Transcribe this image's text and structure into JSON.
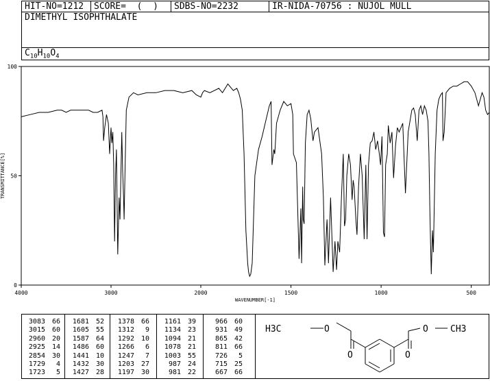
{
  "header": {
    "hit": "HIT-NO=1212",
    "score": "SCORE=  (  )",
    "sdbs": "SDBS-NO=2232",
    "ir": "IR-NIDA-70756 : NUJOL MULL"
  },
  "compound": {
    "name": "DIMETHYL ISOPHTHALATE",
    "formula_parts": [
      "C",
      "10",
      "H",
      "10",
      "O",
      "4"
    ]
  },
  "structure_labels": {
    "left_methyl": "H3C",
    "right_methyl": "CH3",
    "o_left_ester": "O",
    "o_right_ester": "O",
    "o_left_carbonyl": "O",
    "o_right_carbonyl": "O"
  },
  "chart_data": {
    "type": "line",
    "title": "",
    "xlabel": "WAVENUMBER[-1]",
    "ylabel": "TRANSMITTANCE[%]",
    "xlim": [
      4000,
      400
    ],
    "ylim": [
      0,
      100
    ],
    "x_ticks": [
      4000,
      3000,
      2000,
      1500,
      1000,
      500
    ],
    "y_ticks": [
      0,
      50,
      100
    ],
    "x": [
      4000,
      3900,
      3800,
      3700,
      3600,
      3550,
      3500,
      3450,
      3400,
      3350,
      3300,
      3250,
      3200,
      3150,
      3100,
      3090,
      3083,
      3070,
      3050,
      3030,
      3015,
      3000,
      2990,
      2980,
      2970,
      2960,
      2950,
      2940,
      2925,
      2910,
      2900,
      2890,
      2880,
      2870,
      2860,
      2854,
      2845,
      2830,
      2800,
      2750,
      2700,
      2600,
      2500,
      2400,
      2300,
      2200,
      2100,
      2050,
      2000,
      1990,
      1980,
      1950,
      1900,
      1880,
      1850,
      1820,
      1800,
      1790,
      1780,
      1770,
      1760,
      1750,
      1740,
      1735,
      1729,
      1723,
      1715,
      1700,
      1680,
      1660,
      1640,
      1620,
      1610,
      1605,
      1595,
      1590,
      1587,
      1580,
      1560,
      1540,
      1520,
      1500,
      1490,
      1486,
      1470,
      1455,
      1445,
      1441,
      1435,
      1432,
      1427,
      1420,
      1410,
      1400,
      1390,
      1378,
      1370,
      1350,
      1330,
      1320,
      1312,
      1300,
      1292,
      1280,
      1266,
      1256,
      1247,
      1240,
      1230,
      1220,
      1210,
      1203,
      1197,
      1190,
      1180,
      1170,
      1161,
      1155,
      1150,
      1140,
      1134,
      1125,
      1115,
      1105,
      1094,
      1085,
      1078,
      1070,
      1060,
      1050,
      1040,
      1030,
      1020,
      1010,
      1003,
      995,
      987,
      981,
      975,
      966,
      960,
      950,
      940,
      931,
      920,
      910,
      900,
      880,
      865,
      850,
      830,
      820,
      811,
      800,
      790,
      780,
      770,
      760,
      750,
      740,
      735,
      730,
      726,
      722,
      715,
      710,
      700,
      690,
      680,
      670,
      660,
      657,
      650,
      640,
      620,
      600,
      580,
      560,
      540,
      520,
      500,
      480,
      460,
      440,
      430,
      420,
      410,
      400
    ],
    "y": [
      77,
      78,
      79,
      79,
      80,
      80,
      79,
      80,
      80,
      80,
      80,
      80,
      79,
      79,
      80,
      77,
      66,
      72,
      78,
      74,
      60,
      72,
      65,
      70,
      55,
      20,
      50,
      62,
      14,
      40,
      30,
      50,
      70,
      52,
      40,
      30,
      50,
      80,
      86,
      88,
      87,
      88,
      88,
      89,
      89,
      88,
      89,
      87,
      86,
      88,
      89,
      88,
      90,
      88,
      92,
      89,
      90,
      88,
      85,
      80,
      60,
      25,
      10,
      6,
      4,
      5,
      10,
      50,
      62,
      68,
      75,
      82,
      84,
      55,
      62,
      60,
      64,
      74,
      80,
      84,
      82,
      83,
      78,
      60,
      56,
      12,
      35,
      10,
      45,
      30,
      28,
      65,
      78,
      80,
      76,
      66,
      70,
      72,
      60,
      40,
      9,
      30,
      10,
      40,
      6,
      20,
      7,
      20,
      15,
      40,
      60,
      27,
      30,
      50,
      60,
      55,
      39,
      48,
      45,
      30,
      23,
      45,
      60,
      50,
      21,
      55,
      21,
      55,
      65,
      66,
      70,
      62,
      66,
      60,
      55,
      68,
      24,
      22,
      55,
      60,
      73,
      65,
      70,
      49,
      64,
      72,
      70,
      74,
      42,
      70,
      80,
      81,
      78,
      66,
      80,
      82,
      78,
      82,
      80,
      75,
      60,
      35,
      20,
      5,
      25,
      15,
      60,
      80,
      85,
      87,
      88,
      66,
      70,
      88,
      90,
      91,
      91,
      92,
      93,
      93,
      91,
      88,
      82,
      88,
      86,
      80,
      78,
      79
    ]
  },
  "peak_table": [
    [
      [
        3083,
        66
      ],
      [
        3015,
        60
      ],
      [
        2960,
        20
      ],
      [
        2925,
        14
      ],
      [
        2854,
        30
      ],
      [
        1729,
        4
      ],
      [
        1723,
        5
      ]
    ],
    [
      [
        1681,
        52
      ],
      [
        1605,
        55
      ],
      [
        1587,
        64
      ],
      [
        1486,
        60
      ],
      [
        1441,
        10
      ],
      [
        1432,
        30
      ],
      [
        1427,
        28
      ]
    ],
    [
      [
        1378,
        66
      ],
      [
        1312,
        9
      ],
      [
        1292,
        10
      ],
      [
        1266,
        6
      ],
      [
        1247,
        7
      ],
      [
        1203,
        27
      ],
      [
        1197,
        30
      ]
    ],
    [
      [
        1161,
        39
      ],
      [
        1134,
        23
      ],
      [
        1094,
        21
      ],
      [
        1078,
        21
      ],
      [
        1003,
        55
      ],
      [
        987,
        24
      ],
      [
        981,
        22
      ]
    ],
    [
      [
        966,
        60
      ],
      [
        931,
        49
      ],
      [
        865,
        42
      ],
      [
        811,
        66
      ],
      [
        726,
        5
      ],
      [
        715,
        25
      ],
      [
        667,
        66
      ]
    ]
  ]
}
